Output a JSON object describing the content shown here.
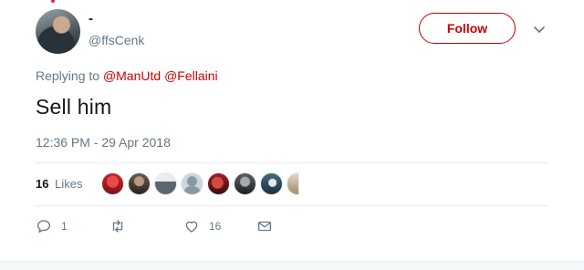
{
  "user": {
    "display_name": "-",
    "handle": "@ffsCenk"
  },
  "follow_button_label": "Follow",
  "reply_context": {
    "prefix": "Replying to",
    "mentions": [
      "@ManUtd",
      "@Fellaini"
    ]
  },
  "tweet": {
    "text": "Sell him",
    "timestamp": "12:36 PM - 29 Apr 2018"
  },
  "stats": {
    "likes_count": "16",
    "likes_label": "Likes"
  },
  "likers": [
    {
      "name": "liker-avatar-1",
      "color": "#c8262b"
    },
    {
      "name": "liker-avatar-2",
      "color": "#4a3d35"
    },
    {
      "name": "liker-avatar-3",
      "color": "#5b6670"
    },
    {
      "name": "liker-avatar-4",
      "color": "#ccd6dd"
    },
    {
      "name": "liker-avatar-5",
      "color": "#9e1f24"
    },
    {
      "name": "liker-avatar-6",
      "color": "#3d4246"
    },
    {
      "name": "liker-avatar-7",
      "color": "#2f5066"
    },
    {
      "name": "liker-avatar-8",
      "color": "#c9b79c"
    }
  ],
  "actions": {
    "reply_count": "1",
    "retweet_count": "",
    "like_count": "16"
  },
  "colors": {
    "accent": "#cc0000",
    "muted": "#657786",
    "text": "#14171a"
  },
  "icons": [
    "caret-down-icon",
    "reply-icon",
    "retweet-icon",
    "heart-icon",
    "envelope-icon"
  ]
}
